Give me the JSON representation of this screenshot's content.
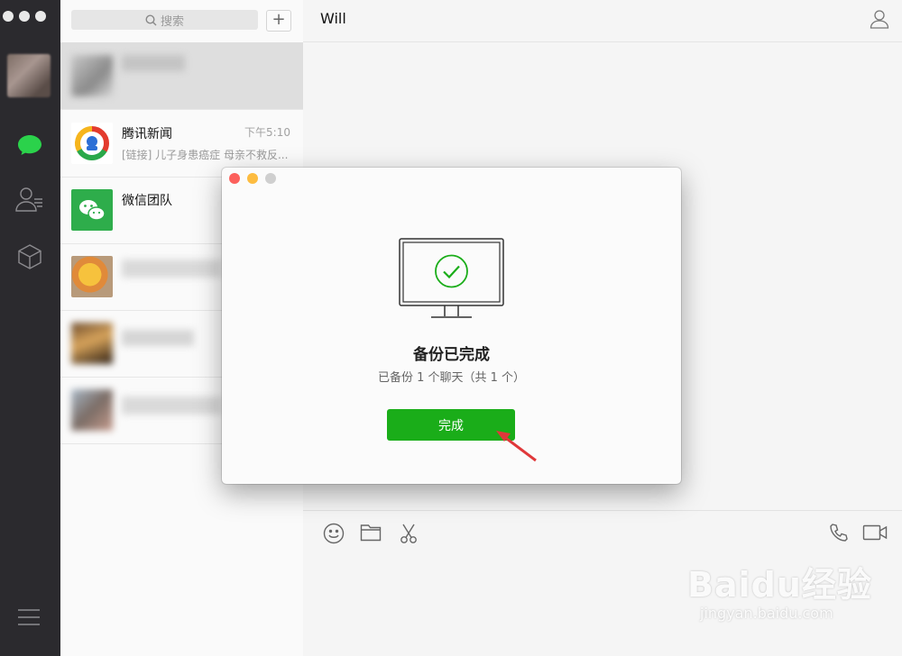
{
  "search": {
    "placeholder": "搜索",
    "add_label": "+"
  },
  "conversations": [
    {
      "name": "",
      "time": "",
      "preview": ""
    },
    {
      "name": "腾讯新闻",
      "time": "下午5:10",
      "preview": "[链接] 儿子身患癌症 母亲不救反..."
    },
    {
      "name": "微信团队",
      "time": "",
      "preview": ""
    },
    {
      "name": "",
      "time": "",
      "preview": ""
    },
    {
      "name": "",
      "time": "",
      "preview": ""
    },
    {
      "name": "",
      "time": "",
      "preview": ""
    }
  ],
  "chat": {
    "title": "Will"
  },
  "dialog": {
    "title": "备份已完成",
    "subtitle": "已备份 1 个聊天（共 1 个）",
    "button_label": "完成"
  },
  "watermark": {
    "line1": "Baidu经验",
    "line2": "jingyan.baidu.com"
  },
  "colors": {
    "accent": "#1aad19",
    "sidebar": "#2b2a2e",
    "arrow": "#e0383a"
  }
}
